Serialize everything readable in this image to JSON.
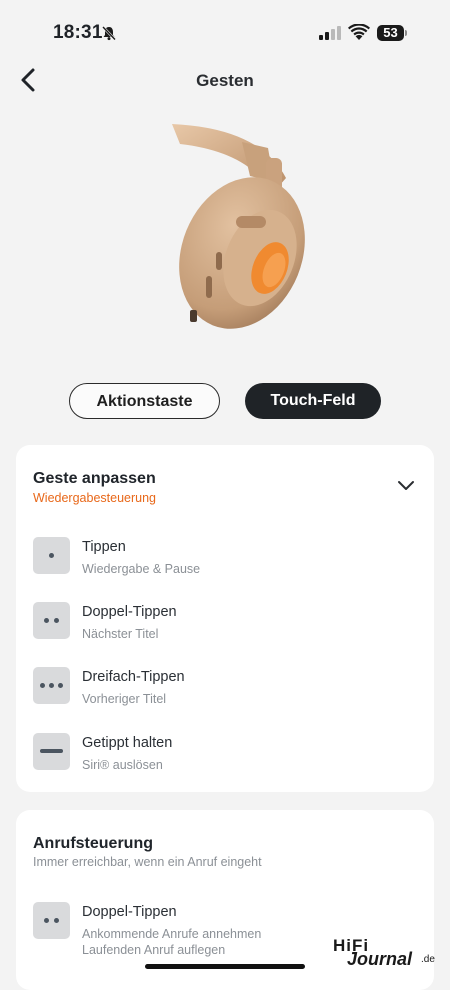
{
  "status_bar": {
    "time": "18:31",
    "battery": "53"
  },
  "nav": {
    "title": "Gesten"
  },
  "tabs": {
    "left": "Aktionstaste",
    "right": "Touch-Feld"
  },
  "card_gestures": {
    "title": "Geste anpassen",
    "subtitle": "Wiedergabesteuerung",
    "subtitle_color": "#e8681a",
    "items": [
      {
        "name": "Tippen",
        "action": "Wiedergabe & Pause",
        "icon": "single-dot-icon"
      },
      {
        "name": "Doppel-Tippen",
        "action": "Nächster Titel",
        "icon": "double-dot-icon"
      },
      {
        "name": "Dreifach-Tippen",
        "action": "Vorheriger Titel",
        "icon": "triple-dot-icon"
      },
      {
        "name": "Getippt halten",
        "action": "Siri® auslösen",
        "icon": "hold-bar-icon"
      }
    ]
  },
  "card_calls": {
    "title": "Anrufsteuerung",
    "subtitle": "Immer erreichbar, wenn ein Anruf eingeht",
    "items": [
      {
        "name": "Doppel-Tippen",
        "action_line1": "Ankommende Anrufe annehmen",
        "action_line2": "Laufenden Anruf auflegen",
        "icon": "double-dot-icon"
      }
    ]
  },
  "watermark": {
    "text_top": "HiFi",
    "text_main": "Journal",
    "text_suffix": ".de"
  }
}
